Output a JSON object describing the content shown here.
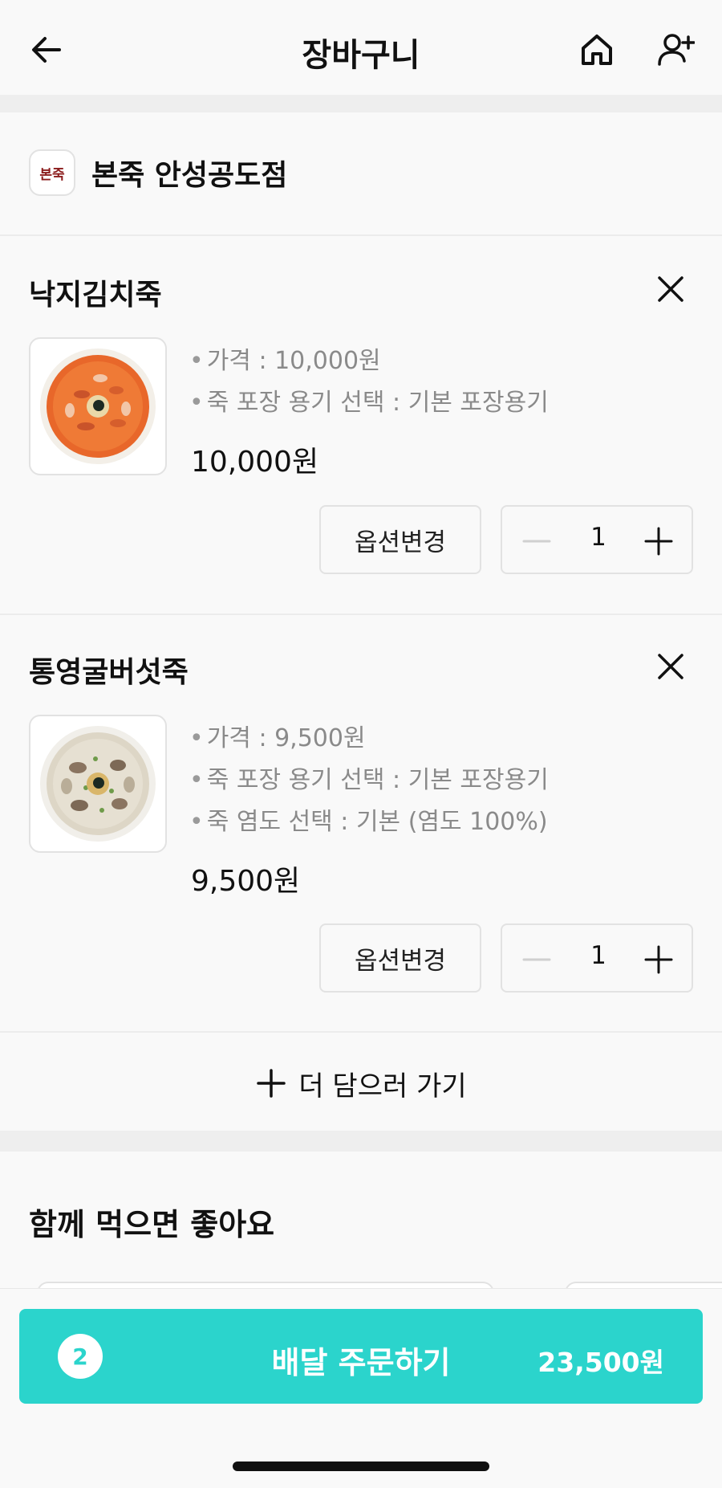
{
  "header": {
    "title": "장바구니",
    "back_icon": "arrow-left-icon",
    "home_icon": "home-icon",
    "add_user_icon": "user-plus-icon"
  },
  "store": {
    "logo_text": "본죽",
    "name": "본죽 안성공도점"
  },
  "items": [
    {
      "name": "낙지김치죽",
      "options": [
        "가격 : 10,000원",
        "죽 포장 용기 선택 : 기본 포장용기"
      ],
      "price": "10,000원",
      "option_button": "옵션변경",
      "quantity": "1"
    },
    {
      "name": "통영굴버섯죽",
      "options": [
        "가격 : 9,500원",
        "죽 포장 용기 선택 : 기본 포장용기",
        "죽 염도 선택 : 기본 (염도 100%)"
      ],
      "price": "9,500원",
      "option_button": "옵션변경",
      "quantity": "1"
    }
  ],
  "add_more_label": "더 담으러 가기",
  "recommend_title": "함께 먹으면 좋아요",
  "order": {
    "count": "2",
    "label": "배달 주문하기",
    "total": "23,500원"
  },
  "colors": {
    "accent": "#2bd4cc",
    "background": "#f9f9f9",
    "muted_text": "#8a8a8a"
  }
}
